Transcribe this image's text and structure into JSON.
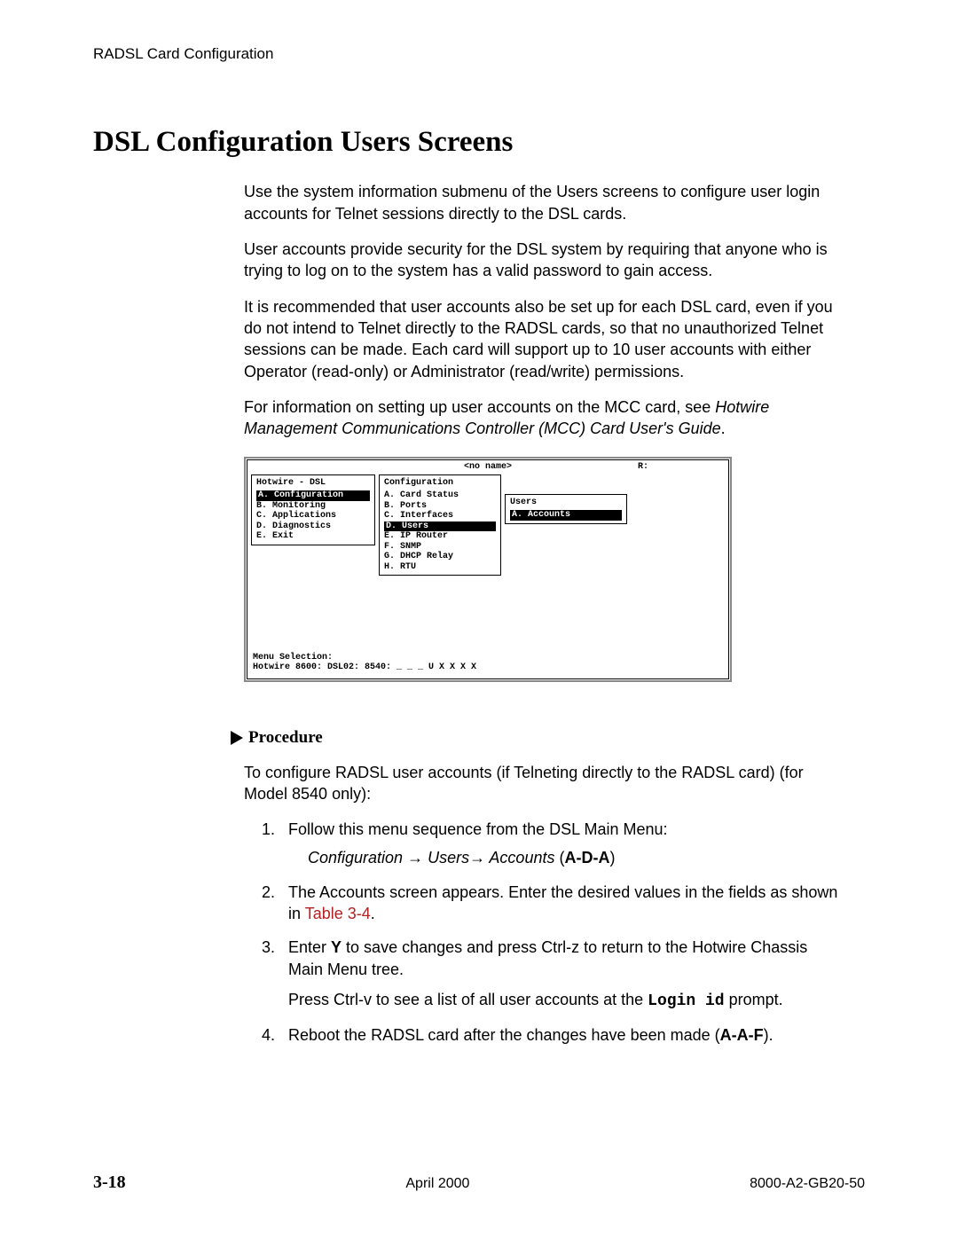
{
  "header": {
    "section": "RADSL Card Configuration"
  },
  "title": "DSL Configuration Users Screens",
  "p1": "Use the system information submenu of the Users screens to configure user login accounts for Telnet sessions directly to the DSL cards.",
  "p2": "User accounts provide security for the DSL system by requiring that anyone who is trying to log on to the system has a valid password to gain access.",
  "p3": "It is recommended that user accounts also be set up for each DSL card, even if you do not intend to Telnet directly to the RADSL cards, so that no unauthorized Telnet sessions can be made. Each card will support up to 10 user accounts with either Operator (read-only) or Administrator (read/write) permissions.",
  "p4a": "For information on setting up user accounts on the MCC card, see ",
  "p4b": "Hotwire Management Communications Controller (MCC) Card User's Guide",
  "p4c": ".",
  "screenshot": {
    "topbar_name": "<no name>",
    "topbar_r": "R:",
    "box1_title": "Hotwire - DSL",
    "box1_a": "A. Configuration",
    "box1_b": "B. Monitoring",
    "box1_c": "C. Applications",
    "box1_d": "D. Diagnostics",
    "box1_e": "E. Exit",
    "box2_title": "Configuration",
    "box2_a": "A. Card Status",
    "box2_b": "B. Ports",
    "box2_c": "C. Interfaces",
    "box2_d": "D. Users",
    "box2_e": "E. IP Router",
    "box2_f": "F. SNMP",
    "box2_g": "G. DHCP Relay",
    "box2_h": "H. RTU",
    "box3_title": "Users",
    "box3_a": "A. Accounts",
    "status1": "Menu Selection:",
    "status2": "Hotwire 8600: DSL02: 8540: _ _ _ U  X X X X"
  },
  "procedure_label": "Procedure",
  "proc_intro": "To configure RADSL user accounts (if Telneting directly to the RADSL card) (for Model 8540 only):",
  "step1_text": "Follow this menu sequence from the DSL Main Menu:",
  "step1_path_a": "Configuration ",
  "step1_arr1": "→",
  "step1_path_b": " Users",
  "step1_arr2": "→",
  "step1_path_c": " Accounts ",
  "step1_path_d": "(",
  "step1_code": "A-D-A",
  "step1_path_e": ")",
  "step2_a": "The Accounts screen appears. Enter the desired values in the fields as shown in ",
  "step2_link": "Table 3-4",
  "step2_b": ".",
  "step3_a": "Enter ",
  "step3_y": "Y",
  "step3_b": " to save changes and press Ctrl-z to return to the Hotwire Chassis Main Menu tree.",
  "step3_c": "Press Ctrl-v to see a list of all user accounts at the ",
  "step3_login": "Login id",
  "step3_d": " prompt.",
  "step4_a": "Reboot the RADSL card after the changes have been made (",
  "step4_code": "A-A-F",
  "step4_b": ").",
  "footer": {
    "page": "3-18",
    "date": "April 2000",
    "doc": "8000-A2-GB20-50"
  }
}
